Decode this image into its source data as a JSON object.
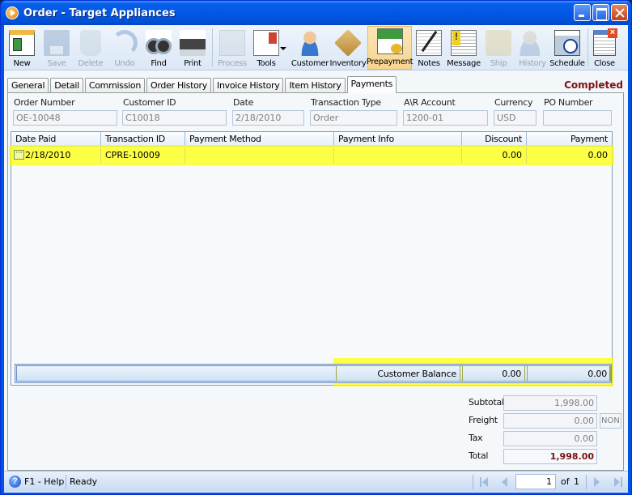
{
  "window": {
    "title": "Order - Target Appliances",
    "controls": [
      "minimize",
      "maximize",
      "close"
    ]
  },
  "toolbar": {
    "buttons": [
      {
        "label": "New",
        "icon": "new-document-icon",
        "enabled": true
      },
      {
        "label": "Save",
        "icon": "floppy-disk-icon",
        "enabled": false
      },
      {
        "label": "Delete",
        "icon": "recycle-bin-icon",
        "enabled": false
      },
      {
        "label": "Undo",
        "icon": "undo-arrow-icon",
        "enabled": false
      },
      {
        "label": "Find",
        "icon": "binoculars-icon",
        "enabled": true
      },
      {
        "label": "Print",
        "icon": "printer-icon",
        "enabled": true
      },
      {
        "label": "Process",
        "icon": "process-gear-icon",
        "enabled": false
      },
      {
        "label": "Tools",
        "icon": "tools-icon",
        "enabled": true,
        "has_dropdown": true
      },
      {
        "label": "Customer",
        "icon": "customer-person-icon",
        "enabled": true
      },
      {
        "label": "Inventory",
        "icon": "boxes-icon",
        "enabled": true
      },
      {
        "label": "Prepayment",
        "icon": "prepayment-coins-icon",
        "enabled": true,
        "active": true
      },
      {
        "label": "Notes",
        "icon": "notepad-pen-icon",
        "enabled": true
      },
      {
        "label": "Message",
        "icon": "message-alert-icon",
        "enabled": true
      },
      {
        "label": "Ship",
        "icon": "forklift-icon",
        "enabled": false
      },
      {
        "label": "History",
        "icon": "history-person-hourglass-icon",
        "enabled": false
      },
      {
        "label": "Schedule",
        "icon": "schedule-calendar-clock-icon",
        "enabled": true
      },
      {
        "label": "Close",
        "icon": "close-window-icon",
        "enabled": true
      }
    ]
  },
  "tabs": [
    {
      "label": "General",
      "active": false
    },
    {
      "label": "Detail",
      "active": false
    },
    {
      "label": "Commission",
      "active": false
    },
    {
      "label": "Order History",
      "active": false
    },
    {
      "label": "Invoice History",
      "active": false
    },
    {
      "label": "Item History",
      "active": false
    },
    {
      "label": "Payments",
      "active": true
    }
  ],
  "status_label": "Completed",
  "header_fields": {
    "order_number": {
      "label": "Order Number",
      "value": "OE-10048"
    },
    "customer_id": {
      "label": "Customer ID",
      "value": "C10018"
    },
    "date": {
      "label": "Date",
      "value": "2/18/2010"
    },
    "transaction_type": {
      "label": "Transaction Type",
      "value": "Order"
    },
    "ar_account": {
      "label": "A\\R Account",
      "value": "1200-01"
    },
    "currency": {
      "label": "Currency",
      "value": "USD"
    },
    "po_number": {
      "label": "PO Number",
      "value": ""
    }
  },
  "payments_grid": {
    "columns": [
      "Date Paid",
      "Transaction ID",
      "Payment Method",
      "Payment Info",
      "Discount",
      "Payment"
    ],
    "rows": [
      {
        "date_paid": "2/18/2010",
        "transaction_id": "CPRE-10009",
        "payment_method": "",
        "payment_info": "",
        "discount": "0.00",
        "payment": "0.00",
        "highlighted": true
      }
    ],
    "footer": {
      "label": "Customer Balance",
      "discount_total": "0.00",
      "payment_total": "0.00"
    },
    "highlight_color": "#ffff00"
  },
  "totals": {
    "subtotal": {
      "label": "Subtotal",
      "value": "1,998.00"
    },
    "freight": {
      "label": "Freight",
      "value": "0.00",
      "code": "NON"
    },
    "tax": {
      "label": "Tax",
      "value": "0.00"
    },
    "total": {
      "label": "Total",
      "value": "1,998.00"
    }
  },
  "statusbar": {
    "help": "F1 - Help",
    "status": "Ready",
    "page_current": "1",
    "page_of": "of",
    "page_total": "1"
  },
  "colors": {
    "status_completed": "#7b1113",
    "total_value": "#7b1113",
    "title_bar": "#0058e6",
    "active_tool": "#f7d48e"
  }
}
